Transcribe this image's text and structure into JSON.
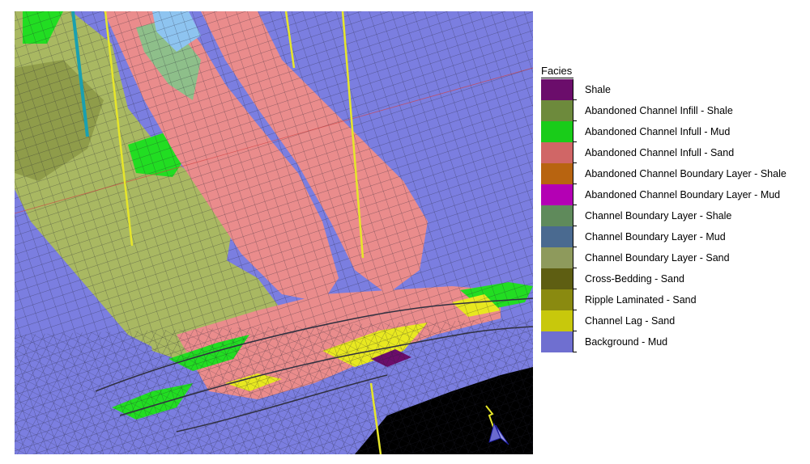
{
  "legend": {
    "title": "Facies",
    "items": [
      {
        "label": "Shale",
        "color": "#6b0d6b"
      },
      {
        "label": "Abandoned Channel Infill - Shale",
        "color": "#6d8a3c"
      },
      {
        "label": "Abandoned Channel Infull - Mud",
        "color": "#19cc19"
      },
      {
        "label": "Abandoned Channel Infull - Sand",
        "color": "#d06666"
      },
      {
        "label": "Abandoned Channel Boundary Layer - Shale",
        "color": "#b86410"
      },
      {
        "label": "Abandoned Channel Boundary Layer - Mud",
        "color": "#b400b4"
      },
      {
        "label": "Channel Boundary Layer - Shale",
        "color": "#5f8a5b"
      },
      {
        "label": "Channel Boundary Layer - Mud",
        "color": "#4a6a90"
      },
      {
        "label": "Channel Boundary Layer - Sand",
        "color": "#8e9a5c"
      },
      {
        "label": "Cross-Bedding - Sand",
        "color": "#5e5e12"
      },
      {
        "label": "Ripple Laminated - Sand",
        "color": "#8a8a10"
      },
      {
        "label": "Channel Lag - Sand",
        "color": "#c8c80c"
      },
      {
        "label": "Background - Mud",
        "color": "#6f6fd0"
      }
    ]
  },
  "viewport": {
    "surface_colors": {
      "background": "#7b7ee0",
      "sand": "#ea8c8c",
      "shale": "#a9b862",
      "lag": "#e8e820",
      "mud_green": "#22dd22",
      "void": "#000000",
      "well": "#e6e62a",
      "well_blue": "#1aa0b0"
    },
    "icons": [
      "axis-orientation-icon"
    ]
  }
}
